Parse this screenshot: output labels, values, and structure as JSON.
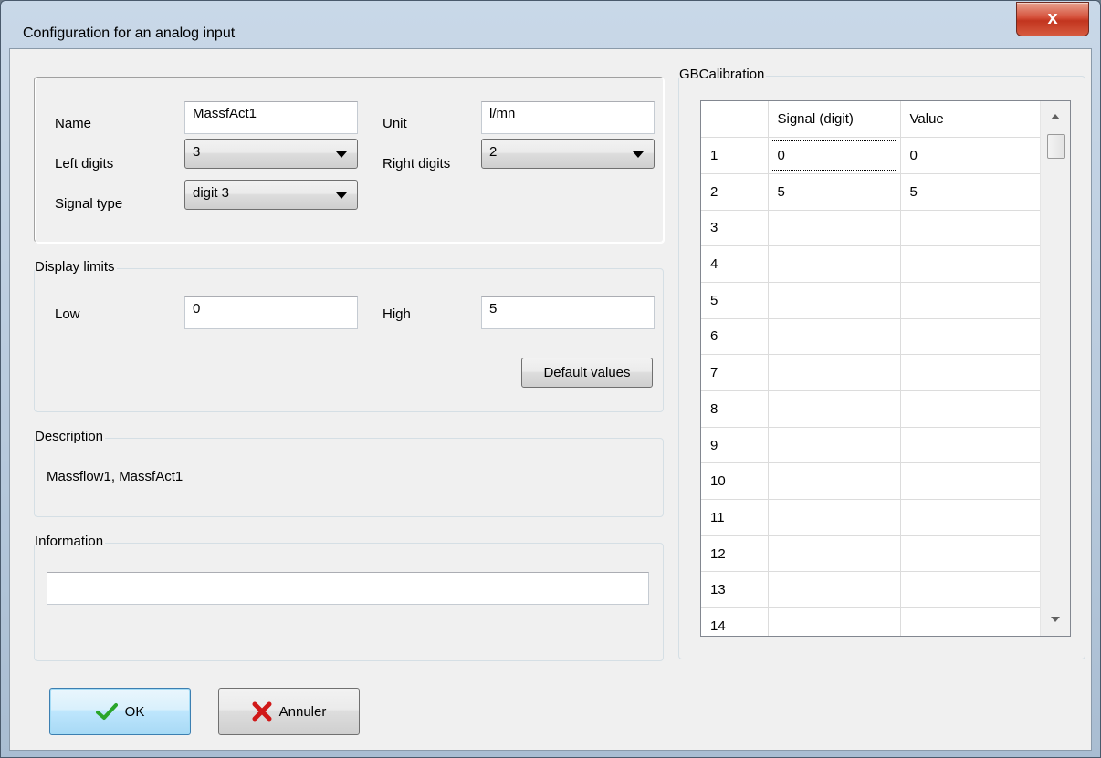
{
  "window": {
    "title": "Configuration for an analog input",
    "close_glyph": "x"
  },
  "general": {
    "name_label": "Name",
    "name_value": "MassfAct1",
    "unit_label": "Unit",
    "unit_value": "l/mn",
    "left_digits_label": "Left digits",
    "left_digits_value": "3",
    "right_digits_label": "Right digits",
    "right_digits_value": "2",
    "signal_type_label": "Signal type",
    "signal_type_value": "digit 3"
  },
  "display_limits": {
    "legend": "Display limits",
    "low_label": "Low",
    "low_value": "0",
    "high_label": "High",
    "high_value": "5",
    "default_button": "Default values"
  },
  "description": {
    "legend": "Description",
    "text": "Massflow1, MassfAct1"
  },
  "information": {
    "legend": "Information",
    "value": ""
  },
  "calibration": {
    "legend": "GBCalibration",
    "columns": [
      "",
      "Signal (digit)",
      "Value"
    ],
    "rows": [
      [
        "1",
        "0",
        "0"
      ],
      [
        "2",
        "5",
        "5"
      ],
      [
        "3",
        "",
        ""
      ],
      [
        "4",
        "",
        ""
      ],
      [
        "5",
        "",
        ""
      ],
      [
        "6",
        "",
        ""
      ],
      [
        "7",
        "",
        ""
      ],
      [
        "8",
        "",
        ""
      ],
      [
        "9",
        "",
        ""
      ],
      [
        "10",
        "",
        ""
      ],
      [
        "11",
        "",
        ""
      ],
      [
        "12",
        "",
        ""
      ],
      [
        "13",
        "",
        ""
      ],
      [
        "14",
        "",
        ""
      ]
    ]
  },
  "buttons": {
    "ok": "OK",
    "cancel": "Annuler"
  },
  "colors": {
    "ok_check": "#2aa52a",
    "cancel_x": "#d01818",
    "close_button": "#c9452f"
  },
  "icons": {
    "ok": "checkmark-icon",
    "cancel": "red-x-icon",
    "close": "close-icon"
  }
}
